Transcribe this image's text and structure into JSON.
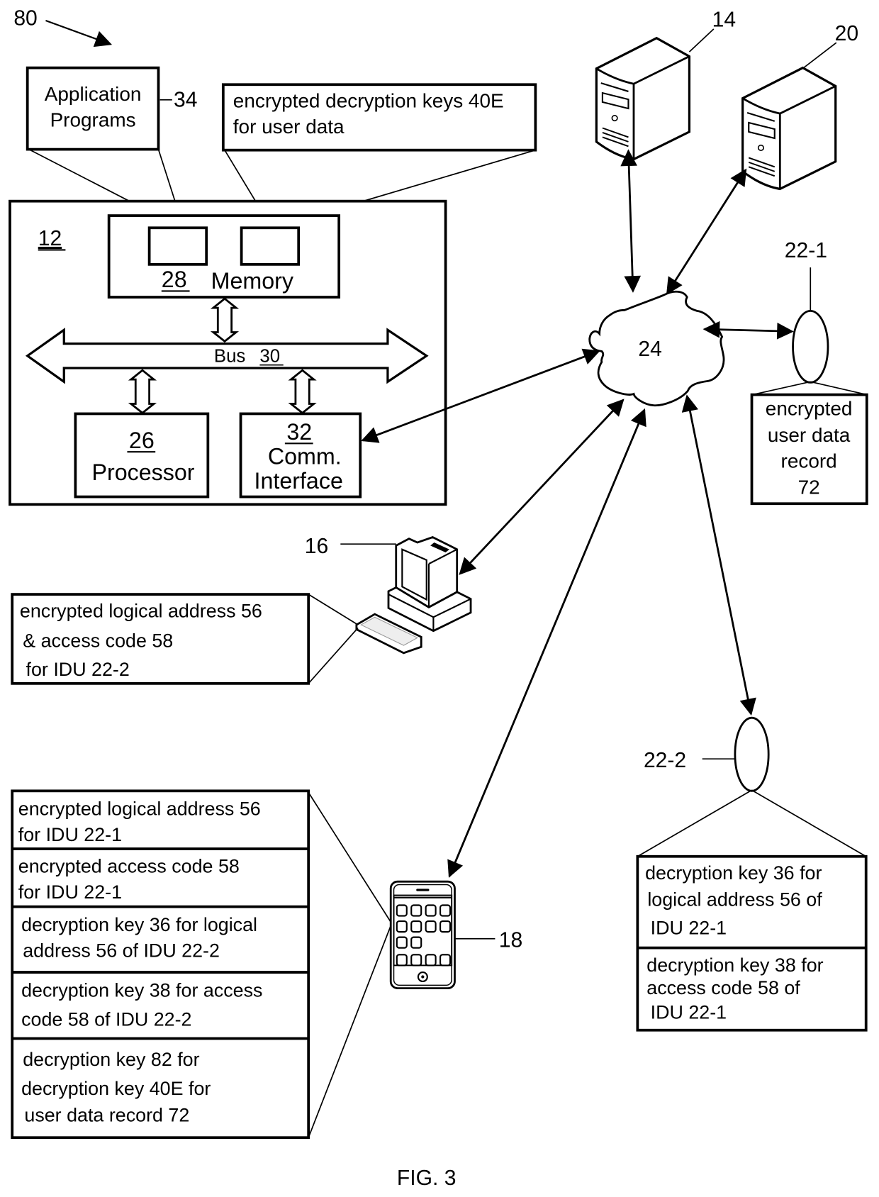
{
  "figure": {
    "caption": "FIG. 3",
    "system_ref": "80"
  },
  "device_12": {
    "ref": "12",
    "memory": {
      "ref": "28",
      "label": "Memory"
    },
    "bus": {
      "label": "Bus",
      "ref": "30"
    },
    "processor": {
      "ref": "26",
      "label": "Processor"
    },
    "comm_interface": {
      "ref": "32",
      "label_line1": "Comm.",
      "label_line2": "Interface"
    }
  },
  "callouts": {
    "application_programs": {
      "line1": "Application",
      "line2": "Programs",
      "ref": "34"
    },
    "encrypted_keys": {
      "line1": "encrypted decryption keys 40E",
      "line2": "for user data"
    }
  },
  "nodes": {
    "server_14": {
      "ref": "14"
    },
    "server_20": {
      "ref": "20"
    },
    "network_24": {
      "ref": "24"
    },
    "computer_16": {
      "ref": "16"
    },
    "phone_18": {
      "ref": "18"
    },
    "idu_22_1": {
      "ref": "22-1"
    },
    "idu_22_2": {
      "ref": "22-2"
    }
  },
  "idu_22_1_record": {
    "lines": [
      "encrypted",
      "user data",
      "record",
      "72"
    ]
  },
  "computer_16_box": {
    "lines": [
      "encrypted logical address  56",
      "& access code 58",
      "for IDU 22-2"
    ]
  },
  "phone_18_box": {
    "sections": [
      {
        "lines": [
          "encrypted logical address 56",
          "for IDU 22-1"
        ]
      },
      {
        "lines": [
          "encrypted access code 58",
          "for IDU 22-1"
        ]
      },
      {
        "lines": [
          "decryption key 36 for logical",
          "address 56 of IDU 22-2"
        ]
      },
      {
        "lines": [
          "decryption key 38 for access",
          "code 58 of IDU 22-2"
        ]
      },
      {
        "lines": [
          "decryption key 82 for",
          "decryption key 40E for",
          "user data record 72"
        ]
      }
    ]
  },
  "idu_22_2_box": {
    "sections": [
      {
        "lines": [
          "decryption key 36 for",
          "logical address 56 of",
          "IDU 22-1"
        ]
      },
      {
        "lines": [
          "decryption key 38 for",
          "access code 58 of",
          "IDU 22-1"
        ]
      }
    ]
  }
}
